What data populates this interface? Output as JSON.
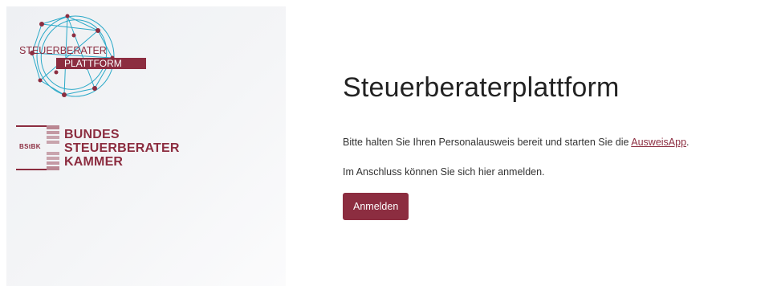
{
  "brand": {
    "platform_logo": {
      "line1": "STEUERBERATER",
      "line2": "PLATTFORM"
    },
    "chamber_logo": {
      "abbr": "BStBK",
      "line1": "BUNDES",
      "line2": "STEUERBERATER",
      "line3": "KAMMER"
    },
    "color": "#8c2d40",
    "accent_color": "#2aa9c8"
  },
  "main": {
    "title": "Steuerberaterplattform",
    "instruction_prefix": "Bitte halten Sie Ihren Personalausweis bereit und starten Sie die ",
    "instruction_link": "AusweisApp",
    "instruction_suffix": ".",
    "followup": "Im Anschluss können Sie sich hier anmelden.",
    "login_button": "Anmelden"
  }
}
